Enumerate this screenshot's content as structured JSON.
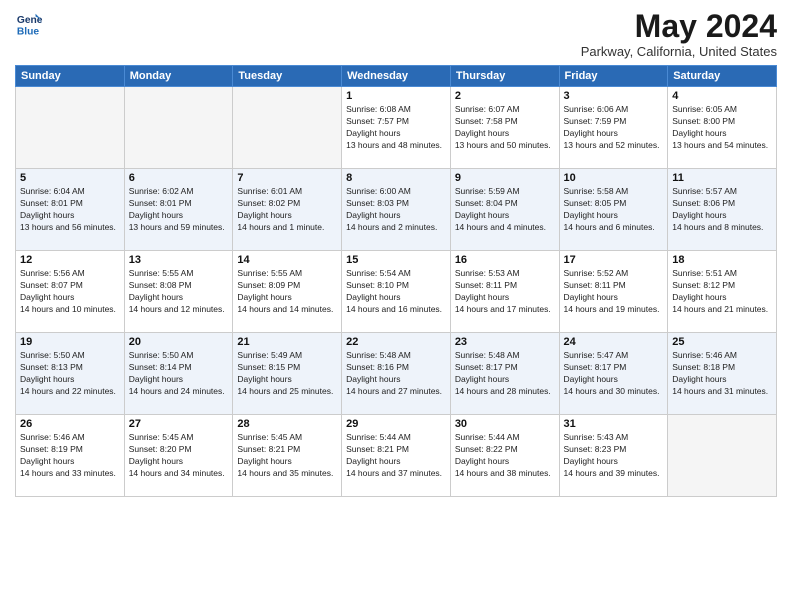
{
  "logo": {
    "line1": "General",
    "line2": "Blue"
  },
  "title": "May 2024",
  "location": "Parkway, California, United States",
  "weekdays": [
    "Sunday",
    "Monday",
    "Tuesday",
    "Wednesday",
    "Thursday",
    "Friday",
    "Saturday"
  ],
  "rows": [
    [
      {
        "day": "",
        "empty": true
      },
      {
        "day": "",
        "empty": true
      },
      {
        "day": "",
        "empty": true
      },
      {
        "day": "1",
        "sunrise": "6:08 AM",
        "sunset": "7:57 PM",
        "daylight": "13 hours and 48 minutes."
      },
      {
        "day": "2",
        "sunrise": "6:07 AM",
        "sunset": "7:58 PM",
        "daylight": "13 hours and 50 minutes."
      },
      {
        "day": "3",
        "sunrise": "6:06 AM",
        "sunset": "7:59 PM",
        "daylight": "13 hours and 52 minutes."
      },
      {
        "day": "4",
        "sunrise": "6:05 AM",
        "sunset": "8:00 PM",
        "daylight": "13 hours and 54 minutes."
      }
    ],
    [
      {
        "day": "5",
        "sunrise": "6:04 AM",
        "sunset": "8:01 PM",
        "daylight": "13 hours and 56 minutes."
      },
      {
        "day": "6",
        "sunrise": "6:02 AM",
        "sunset": "8:01 PM",
        "daylight": "13 hours and 59 minutes."
      },
      {
        "day": "7",
        "sunrise": "6:01 AM",
        "sunset": "8:02 PM",
        "daylight": "14 hours and 1 minute."
      },
      {
        "day": "8",
        "sunrise": "6:00 AM",
        "sunset": "8:03 PM",
        "daylight": "14 hours and 2 minutes."
      },
      {
        "day": "9",
        "sunrise": "5:59 AM",
        "sunset": "8:04 PM",
        "daylight": "14 hours and 4 minutes."
      },
      {
        "day": "10",
        "sunrise": "5:58 AM",
        "sunset": "8:05 PM",
        "daylight": "14 hours and 6 minutes."
      },
      {
        "day": "11",
        "sunrise": "5:57 AM",
        "sunset": "8:06 PM",
        "daylight": "14 hours and 8 minutes."
      }
    ],
    [
      {
        "day": "12",
        "sunrise": "5:56 AM",
        "sunset": "8:07 PM",
        "daylight": "14 hours and 10 minutes."
      },
      {
        "day": "13",
        "sunrise": "5:55 AM",
        "sunset": "8:08 PM",
        "daylight": "14 hours and 12 minutes."
      },
      {
        "day": "14",
        "sunrise": "5:55 AM",
        "sunset": "8:09 PM",
        "daylight": "14 hours and 14 minutes."
      },
      {
        "day": "15",
        "sunrise": "5:54 AM",
        "sunset": "8:10 PM",
        "daylight": "14 hours and 16 minutes."
      },
      {
        "day": "16",
        "sunrise": "5:53 AM",
        "sunset": "8:11 PM",
        "daylight": "14 hours and 17 minutes."
      },
      {
        "day": "17",
        "sunrise": "5:52 AM",
        "sunset": "8:11 PM",
        "daylight": "14 hours and 19 minutes."
      },
      {
        "day": "18",
        "sunrise": "5:51 AM",
        "sunset": "8:12 PM",
        "daylight": "14 hours and 21 minutes."
      }
    ],
    [
      {
        "day": "19",
        "sunrise": "5:50 AM",
        "sunset": "8:13 PM",
        "daylight": "14 hours and 22 minutes."
      },
      {
        "day": "20",
        "sunrise": "5:50 AM",
        "sunset": "8:14 PM",
        "daylight": "14 hours and 24 minutes."
      },
      {
        "day": "21",
        "sunrise": "5:49 AM",
        "sunset": "8:15 PM",
        "daylight": "14 hours and 25 minutes."
      },
      {
        "day": "22",
        "sunrise": "5:48 AM",
        "sunset": "8:16 PM",
        "daylight": "14 hours and 27 minutes."
      },
      {
        "day": "23",
        "sunrise": "5:48 AM",
        "sunset": "8:17 PM",
        "daylight": "14 hours and 28 minutes."
      },
      {
        "day": "24",
        "sunrise": "5:47 AM",
        "sunset": "8:17 PM",
        "daylight": "14 hours and 30 minutes."
      },
      {
        "day": "25",
        "sunrise": "5:46 AM",
        "sunset": "8:18 PM",
        "daylight": "14 hours and 31 minutes."
      }
    ],
    [
      {
        "day": "26",
        "sunrise": "5:46 AM",
        "sunset": "8:19 PM",
        "daylight": "14 hours and 33 minutes."
      },
      {
        "day": "27",
        "sunrise": "5:45 AM",
        "sunset": "8:20 PM",
        "daylight": "14 hours and 34 minutes."
      },
      {
        "day": "28",
        "sunrise": "5:45 AM",
        "sunset": "8:21 PM",
        "daylight": "14 hours and 35 minutes."
      },
      {
        "day": "29",
        "sunrise": "5:44 AM",
        "sunset": "8:21 PM",
        "daylight": "14 hours and 37 minutes."
      },
      {
        "day": "30",
        "sunrise": "5:44 AM",
        "sunset": "8:22 PM",
        "daylight": "14 hours and 38 minutes."
      },
      {
        "day": "31",
        "sunrise": "5:43 AM",
        "sunset": "8:23 PM",
        "daylight": "14 hours and 39 minutes."
      },
      {
        "day": "",
        "empty": true
      }
    ]
  ]
}
